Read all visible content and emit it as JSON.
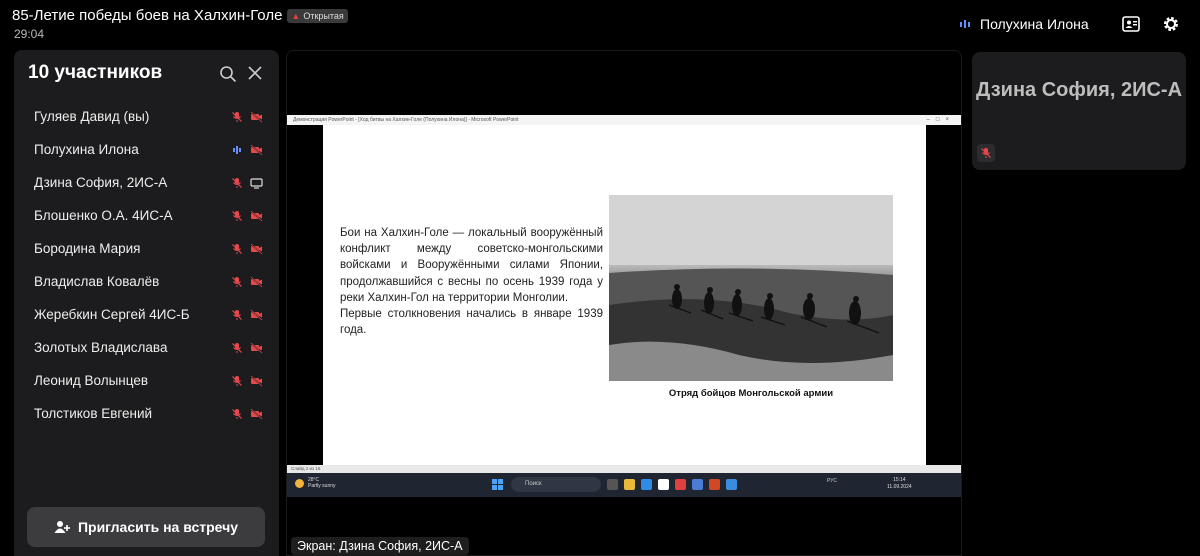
{
  "header": {
    "title": "85-Летие победы боев на Халхин-Голе",
    "badge": "Открытая",
    "timer": "29:04",
    "active_speaker": "Полухина Илона",
    "speaker_indicator_color": "#6a8cff"
  },
  "participants_panel": {
    "title": "10 участников",
    "participants": [
      {
        "name": "Гуляев Давид (вы)",
        "mic": "mic-off",
        "camera": "camera-off"
      },
      {
        "name": "Полухина Илона",
        "mic": "speaking",
        "camera": "camera-off"
      },
      {
        "name": "Дзина София, 2ИС-А",
        "mic": "mic-off",
        "camera": "screen-share"
      },
      {
        "name": "Блошенко О.А. 4ИС-А",
        "mic": "mic-off",
        "camera": "camera-off"
      },
      {
        "name": "Бородина Мария",
        "mic": "mic-off",
        "camera": "camera-off"
      },
      {
        "name": "Владислав Ковалёв",
        "mic": "mic-off",
        "camera": "camera-off"
      },
      {
        "name": "Жеребкин Сергей 4ИС-Б",
        "mic": "mic-off",
        "camera": "camera-off"
      },
      {
        "name": "Золотых Владислава",
        "mic": "mic-off",
        "camera": "camera-off"
      },
      {
        "name": "Леонид Волынцев",
        "mic": "mic-off",
        "camera": "camera-off"
      },
      {
        "name": "Толстиков Евгений",
        "mic": "mic-off",
        "camera": "camera-off"
      }
    ],
    "invite_button": "Пригласить на встречу"
  },
  "shared_screen": {
    "window_title": "Демонстрация PowerPoint - [Ход битвы на Халхин-Голе (Полухина Илона)] - Microsoft PowerPoint",
    "slide_text_1": "Бои на Халхин-Голе — локальный вооружённый конфликт между советско-монгольскими войсками и Вооружёнными силами Японии, продолжавшийся с весны по осень 1939 года у реки Халхин-Гол на территории Монголии.",
    "slide_text_2": "Первые столкновения начались в январе 1939 года.",
    "photo_caption": "Отряд бойцов Монгольской армии",
    "status_bar": "Слайд 2 из 16",
    "weather_temp": "28°C",
    "weather_desc": "Partly sunny",
    "search_placeholder": "Поиск",
    "language": "РУС",
    "time": "15:14",
    "date": "11.09.2024",
    "label": "Экран: Дзина София, 2ИС-А"
  },
  "video_tile": {
    "name": "Дзина София, 2ИС-А",
    "mic": "mic-off"
  },
  "colors": {
    "mute_red": "#e5484d",
    "speaking_blue": "#6a8cff",
    "panel_bg": "#1c1c1e",
    "button_bg": "#3c3c3e"
  }
}
